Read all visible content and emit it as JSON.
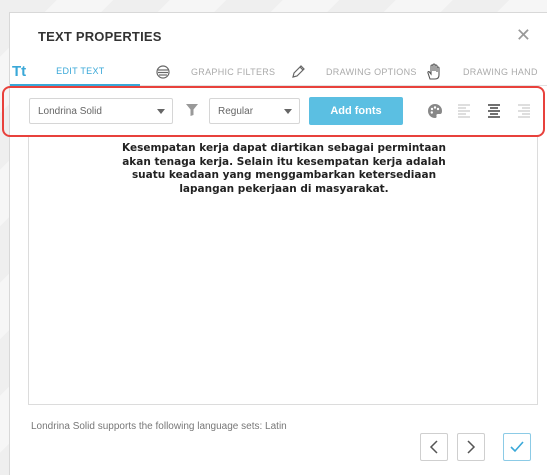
{
  "dialog": {
    "title": "TEXT PROPERTIES",
    "close_icon": "close-icon"
  },
  "tabs": [
    {
      "icon_text": "Tt",
      "label": "EDIT TEXT",
      "active": true
    },
    {
      "icon": "lines-icon",
      "label": "GRAPHIC FILTERS",
      "active": false
    },
    {
      "icon": "pencil-icon",
      "label": "DRAWING OPTIONS",
      "active": false
    },
    {
      "icon": "hand-icon",
      "label": "DRAWING HAND",
      "active": false
    }
  ],
  "toolbar": {
    "font_value": "Londrina Solid",
    "style_value": "Regular",
    "add_fonts_label": "Add fonts"
  },
  "editor": {
    "lines": [
      "Kesempatan kerja dapat diartikan sebagai permintaan",
      "akan tenaga kerja. Selain itu kesempatan kerja adalah",
      "suatu keadaan yang menggambarkan ketersediaan",
      "lapangan pekerjaan di masyarakat."
    ]
  },
  "footer": {
    "language_note": "Londrina Solid supports the following language sets: Latin"
  },
  "colors": {
    "accent": "#3aa8d8",
    "button": "#5bbfe2",
    "highlight": "#e8413c"
  }
}
